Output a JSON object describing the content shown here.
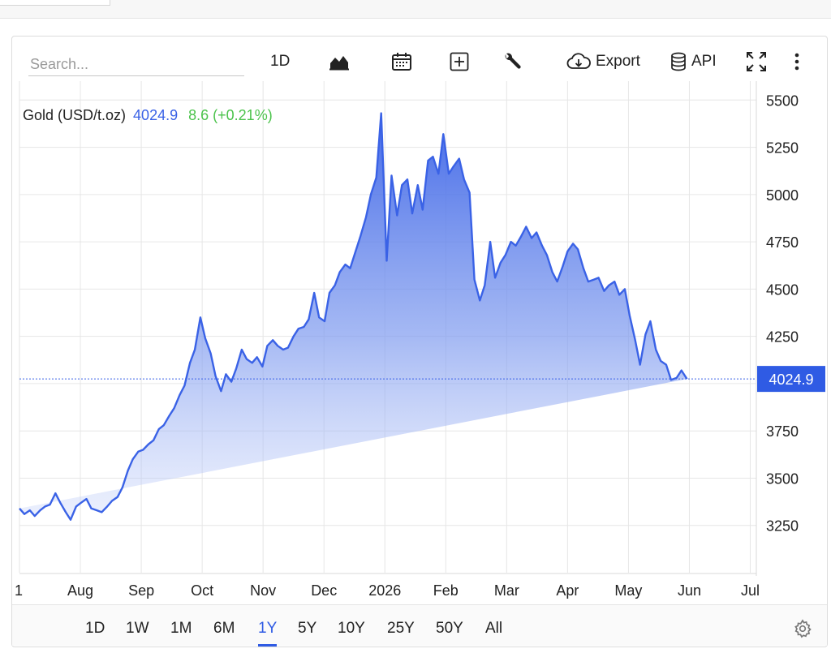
{
  "toolbar": {
    "search_placeholder": "Search...",
    "interval_label": "1D",
    "export_label": "Export",
    "api_label": "API"
  },
  "legend": {
    "name": "Gold (USD/t.oz)",
    "price": "4024.9",
    "change": "8.6 (+0.21%)"
  },
  "colors": {
    "line": "#3a62e6",
    "price_tag": "#2f5be4",
    "change_positive": "#4cc34c"
  },
  "ranges": [
    "1D",
    "1W",
    "1M",
    "6M",
    "1Y",
    "5Y",
    "10Y",
    "25Y",
    "50Y",
    "All"
  ],
  "active_range": "1Y",
  "chart_data": {
    "type": "area",
    "title": "Gold (USD/t.oz)",
    "last_value": 4024.9,
    "last_value_label": "4024.9",
    "ylim": [
      3000,
      5600
    ],
    "y_ticks": [
      3250,
      3500,
      3750,
      4000,
      4250,
      4500,
      4750,
      5000,
      5250,
      5500
    ],
    "y_tick_labels": [
      "3250",
      "3500",
      "3750",
      "",
      "4250",
      "4500",
      "4750",
      "5000",
      "5250",
      "5500"
    ],
    "x_tick_labels": [
      "1",
      "Aug",
      "Sep",
      "Oct",
      "Nov",
      "Dec",
      "2026",
      "Feb",
      "Mar",
      "Apr",
      "May",
      "Jun",
      "Jul"
    ],
    "x_tick_positions": [
      0,
      1,
      2,
      3,
      4,
      5,
      6,
      7,
      8,
      9,
      10,
      11,
      12
    ],
    "xlim": [
      0,
      12.1
    ],
    "grid": true,
    "x": [
      0.0,
      0.08,
      0.17,
      0.25,
      0.34,
      0.42,
      0.5,
      0.59,
      0.67,
      0.76,
      0.84,
      0.93,
      1.01,
      1.1,
      1.18,
      1.27,
      1.35,
      1.44,
      1.52,
      1.61,
      1.69,
      1.78,
      1.86,
      1.95,
      2.03,
      2.12,
      2.2,
      2.29,
      2.37,
      2.46,
      2.54,
      2.63,
      2.71,
      2.8,
      2.88,
      2.97,
      3.05,
      3.14,
      3.22,
      3.31,
      3.39,
      3.48,
      3.56,
      3.65,
      3.73,
      3.82,
      3.9,
      3.99,
      4.07,
      4.16,
      4.24,
      4.33,
      4.41,
      4.5,
      4.58,
      4.67,
      4.75,
      4.84,
      4.92,
      5.01,
      5.09,
      5.18,
      5.26,
      5.35,
      5.43,
      5.52,
      5.6,
      5.69,
      5.77,
      5.86,
      5.94,
      6.03,
      6.11,
      6.2,
      6.28,
      6.37,
      6.45,
      6.54,
      6.62,
      6.71,
      6.79,
      6.88,
      6.96,
      7.05,
      7.13,
      7.22,
      7.3,
      7.39,
      7.47,
      7.56,
      7.64,
      7.73,
      7.81,
      7.9,
      7.98,
      8.07,
      8.15,
      8.24,
      8.32,
      8.41,
      8.49,
      8.58,
      8.66,
      8.75,
      8.83,
      8.92,
      9.0,
      9.09,
      9.17,
      9.26,
      9.34,
      9.43,
      9.51,
      9.6,
      9.68,
      9.77,
      9.85,
      9.94,
      10.02,
      10.11,
      10.19,
      10.28,
      10.36,
      10.45,
      10.53,
      10.62,
      10.7,
      10.79,
      10.87,
      10.96,
      11.04,
      11.13,
      11.21,
      11.3,
      11.38,
      11.47,
      11.55,
      11.64,
      11.72,
      11.81,
      11.89,
      11.98,
      12.06
    ],
    "series": [
      {
        "values": [
          3340,
          3310,
          3330,
          3300,
          3330,
          3350,
          3360,
          3420,
          3370,
          3320,
          3280,
          3350,
          3370,
          3390,
          3340,
          3330,
          3320,
          3350,
          3380,
          3400,
          3450,
          3540,
          3600,
          3640,
          3650,
          3680,
          3700,
          3760,
          3780,
          3830,
          3870,
          3940,
          3990,
          4110,
          4180,
          4350,
          4240,
          4160,
          4040,
          3960,
          4050,
          4010,
          4080,
          4180,
          4130,
          4110,
          4140,
          4090,
          4200,
          4230,
          4200,
          4180,
          4190,
          4250,
          4290,
          4300,
          4340,
          4480,
          4350,
          4330,
          4480,
          4520,
          4590,
          4630,
          4610,
          4700,
          4780,
          4880,
          5000,
          5090,
          5430,
          4650,
          5100,
          4890,
          5050,
          5080,
          4900,
          5050,
          4920,
          5180,
          5200,
          5110,
          5320,
          5110,
          5150,
          5190,
          5080,
          5010,
          4550,
          4440,
          4520,
          4750,
          4560,
          4640,
          4680,
          4750,
          4730,
          4780,
          4830,
          4770,
          4800,
          4730,
          4680,
          4590,
          4540,
          4620,
          4700,
          4740,
          4710,
          4610,
          4540,
          4550,
          4560,
          4490,
          4520,
          4540,
          4470,
          4500,
          4360,
          4230,
          4100,
          4260,
          4330,
          4180,
          4120,
          4100,
          4020,
          4030,
          4070,
          4024.9
        ]
      }
    ]
  }
}
